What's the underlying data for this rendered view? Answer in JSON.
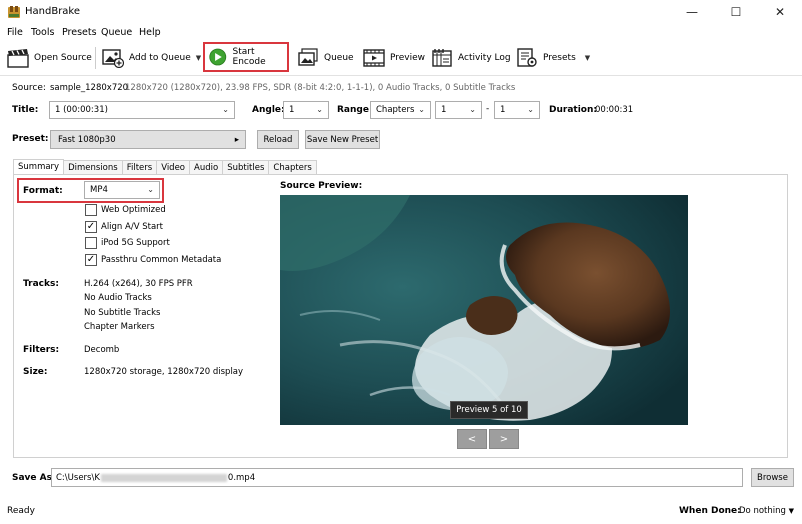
{
  "window": {
    "title": "HandBrake",
    "controls": {
      "minimize": "—",
      "maximize": "☐",
      "close": "✕"
    }
  },
  "menu": [
    "File",
    "Tools",
    "Presets",
    "Queue",
    "Help"
  ],
  "toolbar": {
    "open_source": "Open Source",
    "add_to_queue": "Add to Queue",
    "start_encode": "Start Encode",
    "queue": "Queue",
    "preview": "Preview",
    "activity_log": "Activity Log",
    "presets": "Presets"
  },
  "source": {
    "label": "Source:",
    "name": "sample_1280x720",
    "info": "1280x720 (1280x720), 23.98 FPS, SDR (8-bit 4:2:0, 1-1-1), 0 Audio Tracks, 0 Subtitle Tracks"
  },
  "title_row": {
    "title_label": "Title:",
    "title_value": "1  (00:00:31)",
    "angle_label": "Angle:",
    "angle_value": "1",
    "range_label": "Range:",
    "range_value": "Chapters",
    "range_start": "1",
    "range_dash": "-",
    "range_end": "1",
    "duration_label": "Duration:",
    "duration_value": "00:00:31"
  },
  "preset": {
    "label": "Preset:",
    "value": "Fast 1080p30",
    "arrow": "▸",
    "reload": "Reload",
    "save_new": "Save New Preset"
  },
  "tabs": [
    "Summary",
    "Dimensions",
    "Filters",
    "Video",
    "Audio",
    "Subtitles",
    "Chapters"
  ],
  "summary": {
    "format_label": "Format:",
    "format_value": "MP4",
    "options": [
      {
        "label": "Web Optimized",
        "checked": false,
        "mark": ""
      },
      {
        "label": "Align A/V Start",
        "checked": true,
        "mark": "✓"
      },
      {
        "label": "iPod 5G Support",
        "checked": false,
        "mark": ""
      },
      {
        "label": "Passthru Common Metadata",
        "checked": true,
        "mark": "✓"
      }
    ],
    "tracks_label": "Tracks:",
    "tracks": [
      "H.264 (x264), 30 FPS PFR",
      "No Audio Tracks",
      "No Subtitle Tracks",
      "Chapter Markers"
    ],
    "filters_label": "Filters:",
    "filters_value": "Decomb",
    "size_label": "Size:",
    "size_value": "1280x720 storage, 1280x720 display",
    "source_preview_label": "Source Preview:",
    "preview_counter": "Preview 5 of 10",
    "prev_btn": "<",
    "next_btn": ">"
  },
  "save_as": {
    "label": "Save As:",
    "path_start": "C:\\Users\\K",
    "path_end": "0.mp4",
    "browse": "Browse"
  },
  "status": {
    "text": "Ready",
    "when_done_label": "When Done:",
    "when_done_value": "Do nothing"
  },
  "colors": {
    "highlight": "#d9363e",
    "play_green": "#3ea331"
  }
}
